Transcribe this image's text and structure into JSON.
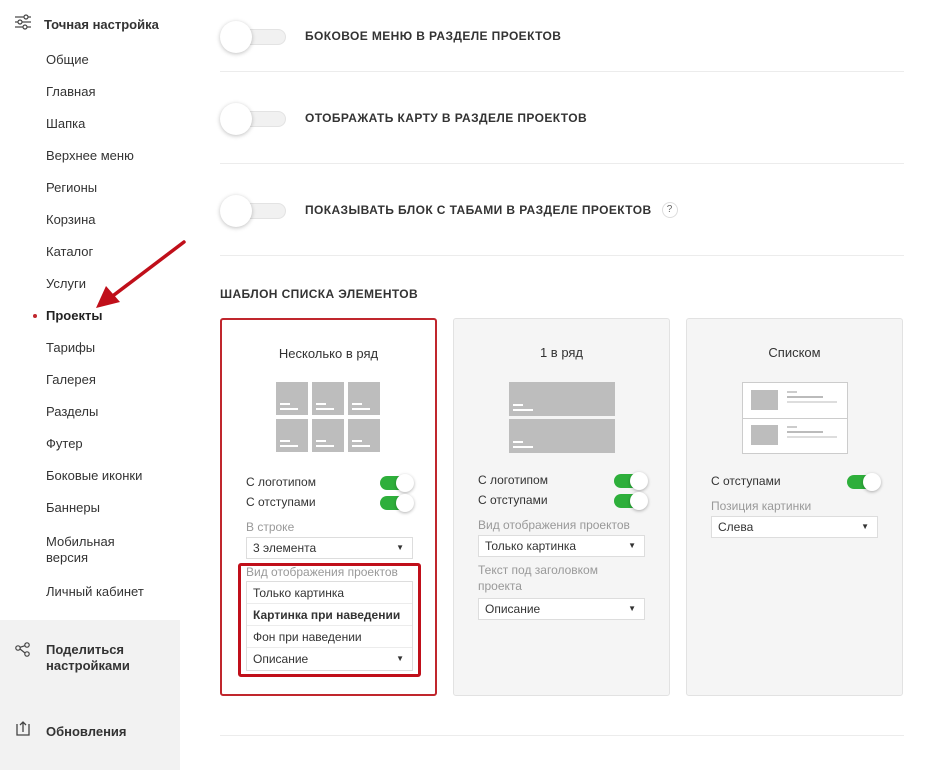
{
  "sidebar": {
    "header": {
      "title": "Точная настройка",
      "icon": "sliders-icon"
    },
    "items": [
      {
        "label": "Общие"
      },
      {
        "label": "Главная"
      },
      {
        "label": "Шапка"
      },
      {
        "label": "Верхнее меню"
      },
      {
        "label": "Регионы"
      },
      {
        "label": "Корзина"
      },
      {
        "label": "Каталог"
      },
      {
        "label": "Услуги"
      },
      {
        "label": "Проекты",
        "active": true
      },
      {
        "label": "Тарифы"
      },
      {
        "label": "Галерея"
      },
      {
        "label": "Разделы"
      },
      {
        "label": "Футер"
      },
      {
        "label": "Боковые иконки"
      },
      {
        "label": "Баннеры"
      },
      {
        "label": "Мобильная версия"
      },
      {
        "label": "Личный кабинет"
      }
    ],
    "share_label": "Поделиться настройками",
    "updates_label": "Обновления"
  },
  "settings": {
    "side_menu_label": "БОКОВОЕ МЕНЮ В РАЗДЕЛЕ ПРОЕКТОВ",
    "map_label": "ОТОБРАЖАТЬ КАРТУ В РАЗДЕЛЕ ПРОЕКТОВ",
    "tabs_label": "ПОКАЗЫВАТЬ БЛОК С ТАБАМИ В РАЗДЕЛЕ ПРОЕКТОВ",
    "help_glyph": "?"
  },
  "template": {
    "title": "ШАБЛОН СПИСКА ЭЛЕМЕНТОВ",
    "card1": {
      "title": "Несколько в ряд",
      "logo_label": "С логотипом",
      "padding_label": "С отступами",
      "in_row_label": "В строке",
      "in_row_value": "3 элемента",
      "view_label": "Вид отображения проектов",
      "view_options": [
        "Только картинка",
        "Картинка при наведении",
        "Фон при наведении"
      ],
      "view_value": "Описание"
    },
    "card2": {
      "title": "1 в ряд",
      "logo_label": "С логотипом",
      "padding_label": "С отступами",
      "view_label": "Вид отображения проектов",
      "view_value": "Только картинка",
      "text_label": "Текст под заголовком проекта",
      "text_value": "Описание"
    },
    "card3": {
      "title": "Списком",
      "padding_label": "С отступами",
      "pos_label": "Позиция картинки",
      "pos_value": "Слева"
    }
  },
  "colors": {
    "accent": "#c0262d",
    "switch_on": "#2eaf3b",
    "highlight_box": "#c00f1a"
  }
}
